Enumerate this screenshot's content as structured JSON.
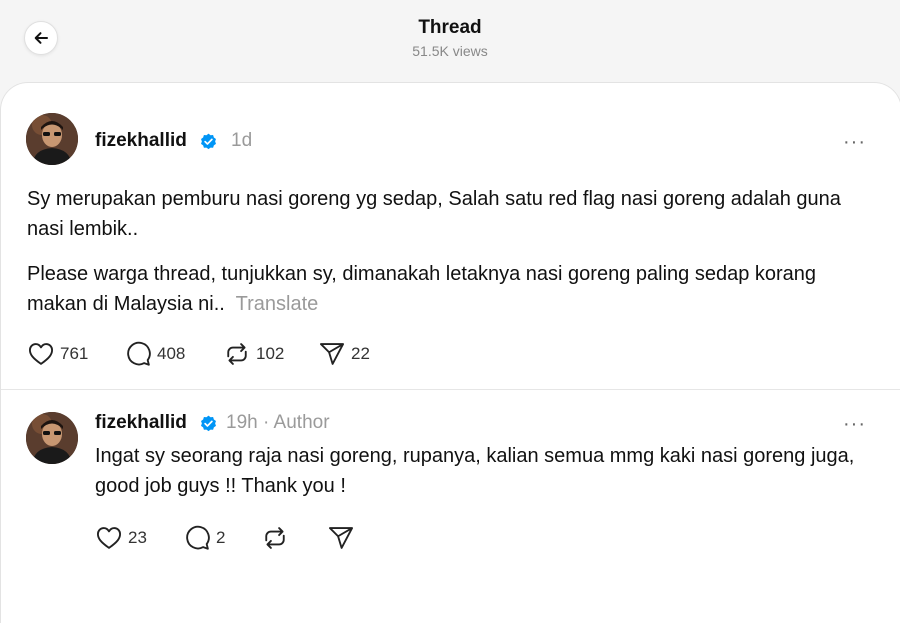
{
  "header": {
    "title": "Thread",
    "views": "51.5K views"
  },
  "post": {
    "username": "fizekhallid",
    "time": "1d",
    "paragraph1": "Sy merupakan pemburu nasi goreng yg sedap, Salah satu red flag nasi goreng adalah guna nasi lembik..",
    "paragraph2": "Please warga thread, tunjukkan sy, dimanakah letaknya nasi goreng paling sedap korang makan di Malaysia ni..",
    "translate": "Translate",
    "more": "···",
    "likes": "761",
    "comments": "408",
    "reposts": "102",
    "shares": "22"
  },
  "reply": {
    "username": "fizekhallid",
    "time": "19h",
    "separator": "·",
    "author_label": "Author",
    "text": "Ingat sy seorang raja nasi goreng, rupanya, kalian semua mmg kaki nasi goreng juga, good job guys !! Thank you !",
    "more": "···",
    "likes": "23",
    "comments": "2"
  },
  "colors": {
    "verified": "#0095f6",
    "muted": "#9a9a9a"
  },
  "icons": [
    "back-arrow-icon",
    "verified-badge-icon",
    "heart-icon",
    "comment-icon",
    "repost-icon",
    "share-icon",
    "more-icon"
  ]
}
